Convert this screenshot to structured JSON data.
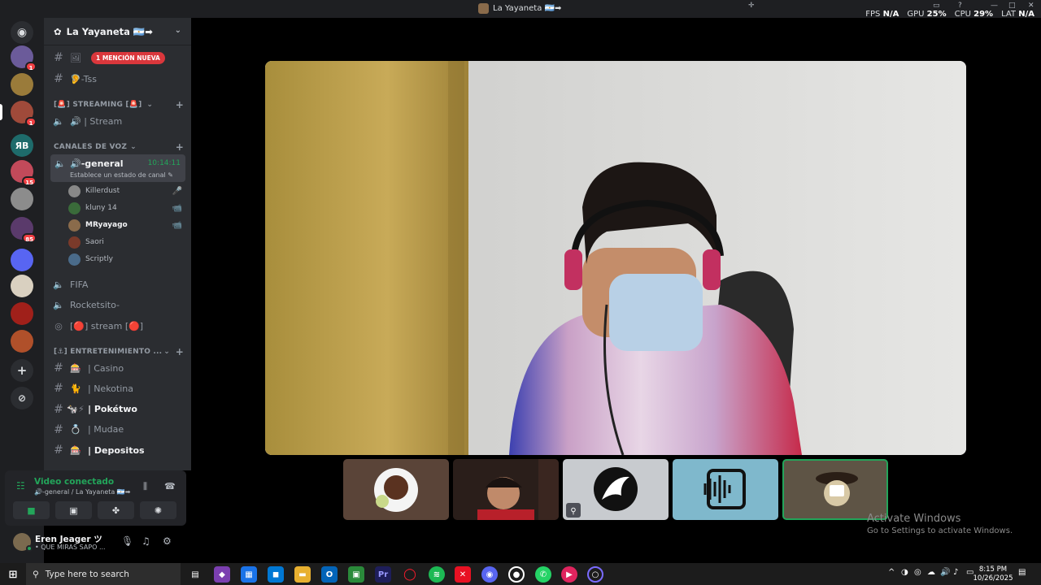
{
  "window": {
    "title": "La Yayaneta 🇦🇷➡",
    "stats": {
      "fps_label": "FPS",
      "fps_value": "N/A",
      "gpu_label": "GPU",
      "gpu_value": "25%",
      "cpu_label": "CPU",
      "cpu_value": "29%",
      "lat_label": "LAT",
      "lat_value": "N/A"
    }
  },
  "rail": {
    "servers": [
      {
        "name": "server-1",
        "initials": "",
        "badge": "1",
        "color": "#6b5b9a"
      },
      {
        "name": "server-2",
        "initials": "",
        "badge": "",
        "color": "#9a7b3a"
      },
      {
        "name": "server-3",
        "initials": "",
        "badge": "1",
        "color": "#a04a3a"
      },
      {
        "name": "server-4",
        "initials": "ЯB",
        "badge": "",
        "color": "#1e6b6b"
      },
      {
        "name": "server-5",
        "initials": "",
        "badge": "15",
        "color": "#c24a5a"
      },
      {
        "name": "server-6",
        "initials": "",
        "badge": "",
        "color": "#8c8c8c"
      },
      {
        "name": "server-7",
        "initials": "",
        "badge": "85",
        "color": "#5a3a6b"
      },
      {
        "name": "server-8",
        "initials": "",
        "badge": "",
        "color": "#5865f2"
      },
      {
        "name": "server-9",
        "initials": "",
        "badge": "",
        "color": "#d9d0c0"
      },
      {
        "name": "server-10",
        "initials": "",
        "badge": "",
        "color": "#a0201a"
      },
      {
        "name": "server-11",
        "initials": "",
        "badge": "",
        "color": "#b0502a"
      }
    ]
  },
  "sidebar": {
    "guild_name": "La Yayaneta 🇦🇷➡",
    "mention_badge": "1 MENCIÓN NUEVA",
    "top_channels": [
      {
        "icon": "🖼",
        "label": ""
      },
      {
        "icon": "🦻",
        "label": "-Tss"
      }
    ],
    "cat_streaming": "[🚨] STREAMING [🚨]",
    "stream_channel": "🔊 | Stream",
    "cat_voice": "CANALES DE VOZ",
    "active_voice": {
      "name": "🔊-general",
      "time": "10:14:11",
      "status": "Establece un estado de canal ✎"
    },
    "voice_users": [
      {
        "name": "Killerdust",
        "right": "🎤",
        "bold": false,
        "color": "#888"
      },
      {
        "name": "kluny 14",
        "right": "📹",
        "bold": false,
        "color": "#3a6b3a"
      },
      {
        "name": "MRyayago",
        "right": "📹",
        "bold": true,
        "color": "#8a6b4b"
      },
      {
        "name": "Saori",
        "right": "",
        "bold": false,
        "color": "#7a3a2a"
      },
      {
        "name": "Scriptly",
        "right": "",
        "bold": false,
        "color": "#4a6b8a"
      }
    ],
    "voice_channels": [
      "FIFA",
      "Rocketsito-",
      "[🔴] stream [🔴]"
    ],
    "cat_entertainment": "[⚓] ENTRETENIMIENTO ...",
    "ent_channels": [
      {
        "icon": "🎰",
        "label": "| Casino",
        "bright": false
      },
      {
        "icon": "🐈",
        "label": "| Nekotina",
        "bright": false
      },
      {
        "icon": "🐄⚡",
        "label": "| Pokétwo",
        "bright": true
      },
      {
        "icon": "💍",
        "label": "| Mudae",
        "bright": false
      },
      {
        "icon": "🎰",
        "label": "| Depositos",
        "bright": true
      }
    ]
  },
  "voice_panel": {
    "title": "Video conectado",
    "subtitle": "🔊-general / La Yayaneta 🇦🇷➡"
  },
  "user": {
    "name": "Eren Jeager ツ",
    "status": "• QUE MIRAS SAPO ..."
  },
  "stage": {
    "tiles": [
      {
        "name": "tile-1",
        "bg": "#5a4438"
      },
      {
        "name": "tile-2",
        "bg": "#2a1e1a"
      },
      {
        "name": "tile-3",
        "bg": "#c8cbcf"
      },
      {
        "name": "tile-4",
        "bg": "#7fb8cc"
      },
      {
        "name": "tile-5",
        "bg": "#5e5445"
      }
    ],
    "activate_title": "Activate Windows",
    "activate_sub": "Go to Settings to activate Windows."
  },
  "taskbar": {
    "search_placeholder": "Type here to search",
    "time": "8:15 PM",
    "date": "10/26/2025"
  }
}
